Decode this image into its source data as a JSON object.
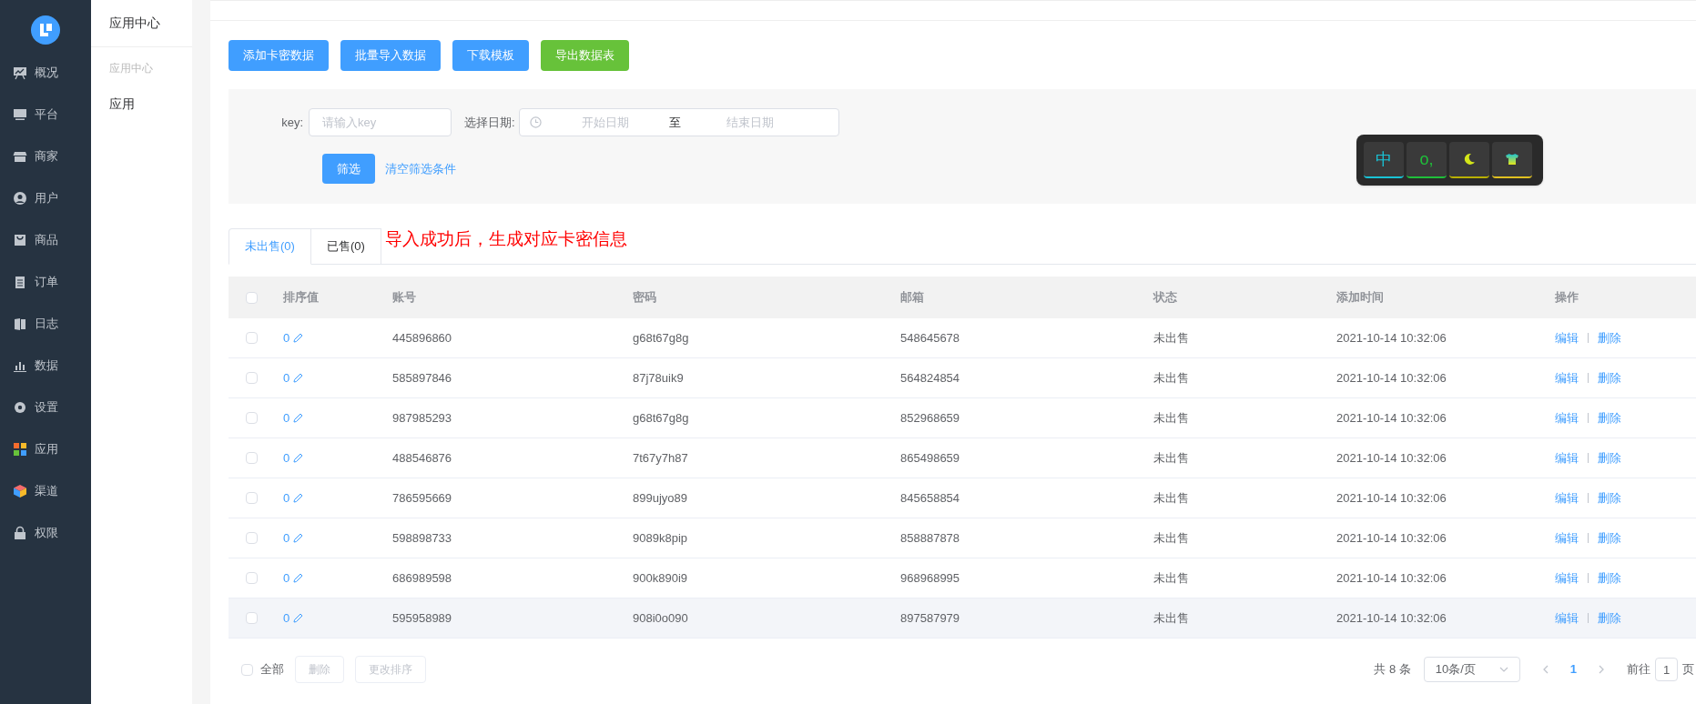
{
  "nav": {
    "items": [
      {
        "label": "概况"
      },
      {
        "label": "平台"
      },
      {
        "label": "商家"
      },
      {
        "label": "用户"
      },
      {
        "label": "商品"
      },
      {
        "label": "订单"
      },
      {
        "label": "日志"
      },
      {
        "label": "数据"
      },
      {
        "label": "设置"
      },
      {
        "label": "应用"
      },
      {
        "label": "渠道"
      },
      {
        "label": "权限"
      }
    ]
  },
  "subnav": {
    "title": "应用中心",
    "group": "应用中心",
    "items": [
      "应用"
    ]
  },
  "actions": [
    {
      "label": "添加卡密数据",
      "kind": "primary"
    },
    {
      "label": "批量导入数据",
      "kind": "primary"
    },
    {
      "label": "下载模板",
      "kind": "primary"
    },
    {
      "label": "导出数据表",
      "kind": "success"
    }
  ],
  "filter": {
    "key_label": "key:",
    "key_placeholder": "请输入key",
    "date_label": "选择日期:",
    "start_placeholder": "开始日期",
    "range_separator": "至",
    "end_placeholder": "结束日期",
    "submit": "筛选",
    "clear": "清空筛选条件"
  },
  "ime_toolbar": {
    "keys": [
      "中",
      "o,"
    ]
  },
  "tabs": [
    {
      "label": "未出售(0)",
      "selected": true
    },
    {
      "label": "已售(0)",
      "selected": false
    }
  ],
  "annotation": "导入成功后，生成对应卡密信息",
  "table": {
    "header_checked": false,
    "columns": [
      "排序值",
      "账号",
      "密码",
      "邮箱",
      "状态",
      "添加时间",
      "操作"
    ],
    "rows": [
      {
        "checked": false,
        "sort": "0",
        "account": "445896860",
        "password": "g68t67g8g",
        "email": "548645678",
        "status": "未出售",
        "added": "2021-10-14 10:32:06",
        "edit": "编辑",
        "delete": "删除",
        "highlighted": false
      },
      {
        "checked": false,
        "sort": "0",
        "account": "585897846",
        "password": "87j78uik9",
        "email": "564824854",
        "status": "未出售",
        "added": "2021-10-14 10:32:06",
        "edit": "编辑",
        "delete": "删除",
        "highlighted": false
      },
      {
        "checked": false,
        "sort": "0",
        "account": "987985293",
        "password": "g68t67g8g",
        "email": "852968659",
        "status": "未出售",
        "added": "2021-10-14 10:32:06",
        "edit": "编辑",
        "delete": "删除",
        "highlighted": false
      },
      {
        "checked": false,
        "sort": "0",
        "account": "488546876",
        "password": "7t67y7h87",
        "email": "865498659",
        "status": "未出售",
        "added": "2021-10-14 10:32:06",
        "edit": "编辑",
        "delete": "删除",
        "highlighted": false
      },
      {
        "checked": false,
        "sort": "0",
        "account": "786595669",
        "password": "899ujyo89",
        "email": "845658854",
        "status": "未出售",
        "added": "2021-10-14 10:32:06",
        "edit": "编辑",
        "delete": "删除",
        "highlighted": false
      },
      {
        "checked": false,
        "sort": "0",
        "account": "598898733",
        "password": "9089k8pip",
        "email": "858887878",
        "status": "未出售",
        "added": "2021-10-14 10:32:06",
        "edit": "编辑",
        "delete": "删除",
        "highlighted": false
      },
      {
        "checked": false,
        "sort": "0",
        "account": "686989598",
        "password": "900k890i9",
        "email": "968968995",
        "status": "未出售",
        "added": "2021-10-14 10:32:06",
        "edit": "编辑",
        "delete": "删除",
        "highlighted": false
      },
      {
        "checked": false,
        "sort": "0",
        "account": "595958989",
        "password": "908i0o090",
        "email": "897587979",
        "status": "未出售",
        "added": "2021-10-14 10:32:06",
        "edit": "编辑",
        "delete": "删除",
        "highlighted": true
      }
    ]
  },
  "footer": {
    "select_all_checked": false,
    "select_all": "全部",
    "delete": "删除",
    "reorder": "更改排序",
    "total": "共 8 条",
    "page_size": "10条/页",
    "pages": [
      {
        "label": "1",
        "selected": true
      }
    ],
    "goto_label": "前往",
    "goto_value": "1",
    "goto_suffix": "页"
  }
}
